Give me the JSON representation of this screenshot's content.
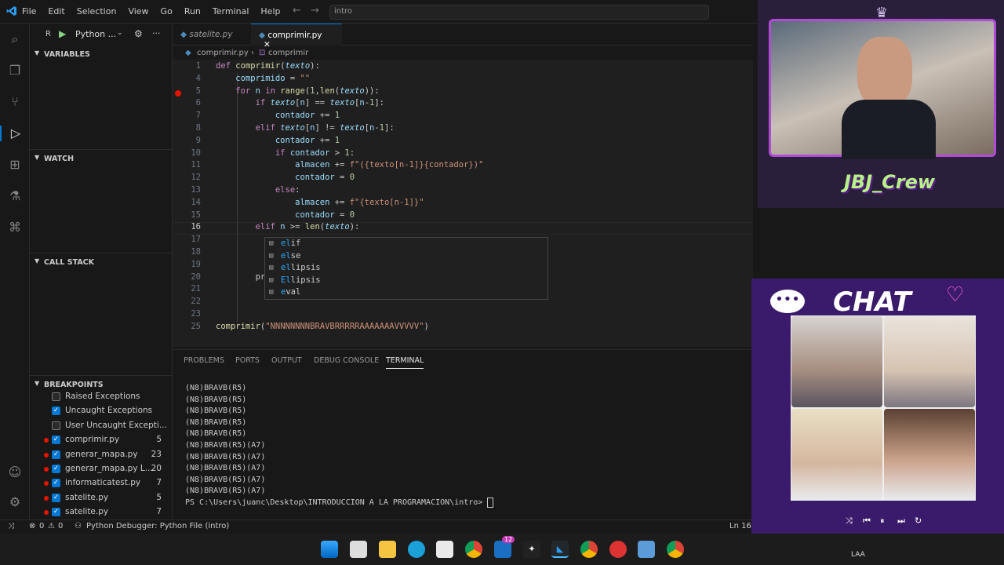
{
  "menu": [
    "File",
    "Edit",
    "Selection",
    "View",
    "Go",
    "Run",
    "Terminal",
    "Help"
  ],
  "search_text": "intro",
  "run_panel": {
    "config": "Python ...",
    "letter": "R"
  },
  "sidebar": {
    "variables": "VARIABLES",
    "watch": "WATCH",
    "call_stack": "CALL STACK",
    "breakpoints": "BREAKPOINTS",
    "bp_items": [
      {
        "label": "Raised Exceptions",
        "checked": false,
        "dot": false,
        "num": ""
      },
      {
        "label": "Uncaught Exceptions",
        "checked": true,
        "dot": false,
        "num": ""
      },
      {
        "label": "User Uncaught Excepti...",
        "checked": false,
        "dot": false,
        "num": ""
      },
      {
        "label": "comprimir.py",
        "checked": true,
        "dot": true,
        "num": "5"
      },
      {
        "label": "generar_mapa.py",
        "checked": true,
        "dot": true,
        "num": "23"
      },
      {
        "label": "generar_mapa.py      L...",
        "checked": true,
        "dot": true,
        "num": "20"
      },
      {
        "label": "informaticatest.py",
        "checked": true,
        "dot": true,
        "num": "7"
      },
      {
        "label": "satelite.py",
        "checked": true,
        "dot": true,
        "num": "5"
      },
      {
        "label": "satelite.py",
        "checked": true,
        "dot": true,
        "num": "7"
      }
    ]
  },
  "tabs": [
    {
      "label": "satelite.py",
      "active": false
    },
    {
      "label": "comprimir.py",
      "active": true
    }
  ],
  "breadcrumb": {
    "file": "comprimir.py",
    "symbol": "comprimir"
  },
  "code_lines": [
    {
      "n": "1",
      "t": "def comprimir(texto):"
    },
    {
      "n": "4",
      "t": "    comprimido = \"\""
    },
    {
      "n": "5",
      "t": "    for n in range(1,len(texto)):"
    },
    {
      "n": "6",
      "t": "        if texto[n] == texto[n-1]:"
    },
    {
      "n": "7",
      "t": "            contador += 1"
    },
    {
      "n": "8",
      "t": "        elif texto[n] != texto[n-1]:"
    },
    {
      "n": "9",
      "t": "            contador += 1"
    },
    {
      "n": "10",
      "t": "            if contador > 1:"
    },
    {
      "n": "11",
      "t": "                almacen += f\"({texto[n-1]}{contador})\""
    },
    {
      "n": "12",
      "t": "                contador = 0"
    },
    {
      "n": "13",
      "t": "            else:"
    },
    {
      "n": "14",
      "t": "                almacen += f\"{texto[n-1]}\""
    },
    {
      "n": "15",
      "t": "                contador = 0"
    },
    {
      "n": "16",
      "t": "        elif n >= len(texto):"
    },
    {
      "n": "17",
      "t": ""
    },
    {
      "n": "18",
      "t": ""
    },
    {
      "n": "19",
      "t": ""
    },
    {
      "n": "20",
      "t": "        pr"
    },
    {
      "n": "21",
      "t": ""
    },
    {
      "n": "22",
      "t": ""
    },
    {
      "n": "23",
      "t": ""
    },
    {
      "n": "25",
      "t": "comprimir(\"NNNNNNNNBRAVBRRRRRAAAAAAAVVVVV\")"
    }
  ],
  "suggestions": [
    {
      "pre": "el",
      "rest": "if"
    },
    {
      "pre": "el",
      "rest": "se"
    },
    {
      "pre": "el",
      "rest": "lipsis"
    },
    {
      "pre": "El",
      "rest": "lipsis"
    },
    {
      "pre": "e",
      "rest": "val"
    }
  ],
  "panel_tabs": [
    "PROBLEMS",
    "PORTS",
    "OUTPUT",
    "DEBUG CONSOLE",
    "TERMINAL"
  ],
  "terminal_lines": [
    "(N8)BRAVB(R5)",
    "(N8)BRAVB(R5)",
    "(N8)BRAVB(R5)",
    "(N8)BRAVB(R5)",
    "(N8)BRAVB(R5)",
    "(N8)BRAVB(R5)(A7)",
    "(N8)BRAVB(R5)(A7)",
    "(N8)BRAVB(R5)(A7)",
    "(N8)BRAVB(R5)(A7)",
    "(N8)BRAVB(R5)(A7)",
    "PS C:\\Users\\juanc\\Desktop\\INTRODUCCION A LA PROGRAMACION\\intro> "
  ],
  "status": {
    "errors": "0",
    "warnings": "0",
    "debugger": "Python Debugger: Python File (intro)",
    "position": "Ln 16,"
  },
  "overlay": {
    "cam_text": "JBJ_Crew",
    "chat_title": "CHAT"
  },
  "taskbar": {
    "badge": "12",
    "lang": "LAA"
  },
  "colors": {
    "accent": "#0078d4",
    "breakpoint": "#e51400"
  }
}
